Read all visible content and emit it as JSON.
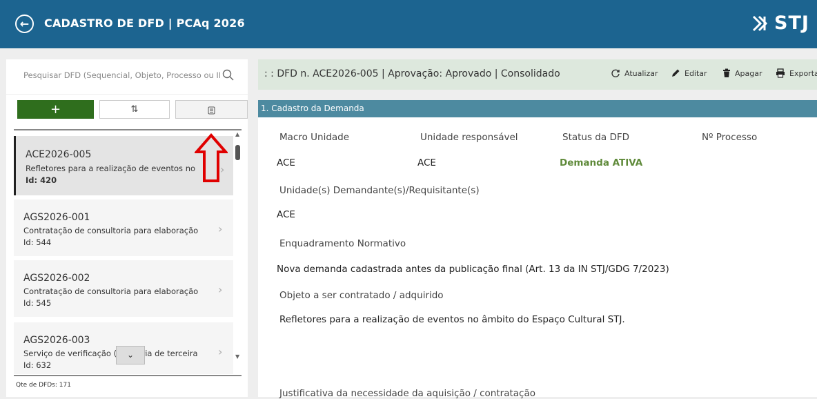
{
  "header": {
    "title": "CADASTRO DE DFD | PCAq 2026",
    "logo_text": "STJ"
  },
  "sidebar": {
    "search_placeholder": "Pesquisar DFD (Sequencial, Objeto, Processo ou ID)",
    "add_label": "+",
    "sort_label": "⇅",
    "items": [
      {
        "code": "ACE2026-005",
        "desc": "Refletores para a realização de eventos no",
        "id": "Id: 420"
      },
      {
        "code": "AGS2026-001",
        "desc": "Contratação de consultoria para elaboração",
        "id": "Id: 544"
      },
      {
        "code": "AGS2026-002",
        "desc": "Contratação de consultoria para elaboração",
        "id": "Id: 545"
      },
      {
        "code": "AGS2026-003",
        "desc": "Serviço de verificação (auditoria de terceira",
        "id": "Id: 632"
      }
    ],
    "count_label": "Qte de DFDs: 171"
  },
  "detail": {
    "title": ": : DFD n. ACE2026-005 | Aprovação: Aprovado | Consolidado",
    "toolbar": {
      "refresh": "Atualizar",
      "edit": "Editar",
      "delete": "Apagar",
      "export": "Exportar"
    },
    "section_title": "1. Cadastro da Demanda",
    "fields": {
      "macro_unidade_label": "Macro Unidade",
      "macro_unidade_value": "ACE",
      "unidade_resp_label": "Unidade responsável",
      "unidade_resp_value": "ACE",
      "status_label": "Status da DFD",
      "status_value": "Demanda ATIVA",
      "processo_label": "Nº Processo",
      "demandantes_label": "Unidade(s) Demandante(s)/Requisitante(s)",
      "demandantes_value": "ACE",
      "enquadramento_label": "Enquadramento Normativo",
      "enquadramento_value": "Nova demanda cadastrada antes da publicação final (Art. 13 da IN STJ/GDG 7/2023)",
      "objeto_label": "Objeto a ser contratado / adquirido",
      "objeto_value": "Refletores para a realização de eventos no âmbito do Espaço Cultural STJ.",
      "justificativa_label": "Justificativa da necessidade da aquisição / contratação"
    }
  },
  "colors": {
    "header_bg": "#1c6490",
    "add_button": "#2f6e1d",
    "section_bar": "#4d8aa0",
    "status_active": "#5f8a3a",
    "annotation_arrow": "#e00000"
  }
}
